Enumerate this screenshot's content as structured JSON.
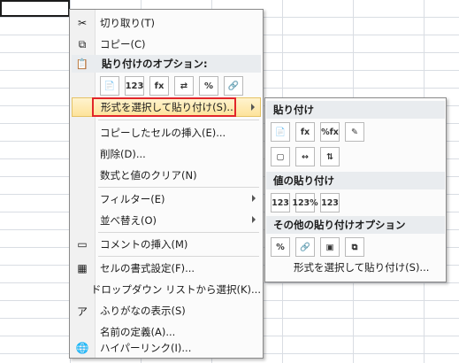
{
  "menu": {
    "items": [
      {
        "label": "切り取り(T)",
        "icon": "scissors-icon"
      },
      {
        "label": "コピー(C)",
        "icon": "copy-icon"
      },
      {
        "label": "貼り付けのオプション:",
        "icon": "clipboard-icon"
      },
      {
        "label": "形式を選択して貼り付け(S)...",
        "icon": ""
      },
      {
        "label": "コピーしたセルの挿入(E)...",
        "icon": ""
      },
      {
        "label": "削除(D)...",
        "icon": ""
      },
      {
        "label": "数式と値のクリア(N)",
        "icon": ""
      },
      {
        "label": "フィルター(E)",
        "icon": ""
      },
      {
        "label": "並べ替え(O)",
        "icon": ""
      },
      {
        "label": "コメントの挿入(M)",
        "icon": "comment-icon"
      },
      {
        "label": "セルの書式設定(F)...",
        "icon": "format-cells-icon"
      },
      {
        "label": "ドロップダウン リストから選択(K)...",
        "icon": ""
      },
      {
        "label": "ふりがなの表示(S)",
        "icon": "furigana-icon"
      },
      {
        "label": "名前の定義(A)...",
        "icon": ""
      },
      {
        "label": "ハイパーリンク(I)...",
        "icon": "hyperlink-icon"
      }
    ],
    "paste_buttons": [
      "📄",
      "123",
      "fx",
      "⇄",
      "%",
      "🔗"
    ]
  },
  "submenu": {
    "sections": [
      "貼り付け",
      "値の貼り付け",
      "その他の貼り付けオプション"
    ],
    "row1": [
      "📄",
      "fx",
      "%fx",
      "✎"
    ],
    "row2": [
      "▢",
      "↔",
      "⇅"
    ],
    "row3": [
      "123",
      "123%",
      "123"
    ],
    "row4": [
      "%",
      "🔗",
      "▣",
      "⧉"
    ],
    "bottom_item": "形式を選択して貼り付け(S)..."
  }
}
